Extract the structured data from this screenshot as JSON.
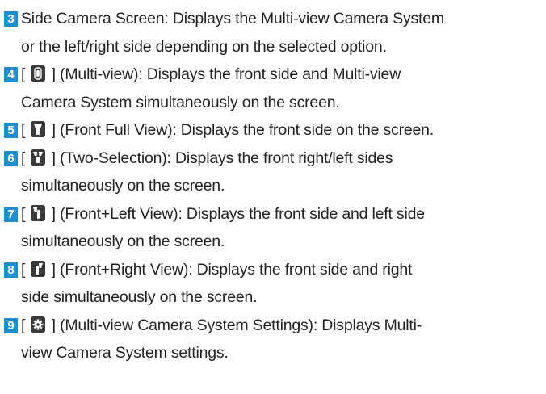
{
  "items": [
    {
      "num": "3",
      "line1": "Side Camera Screen: Displays the Multi-view Camera System",
      "line2": "or the left/right side depending on the selected option."
    },
    {
      "num": "4",
      "icon": "multi-view-icon",
      "line1": "(Multi-view): Displays the front side and Multi-view",
      "line2": "Camera System simultaneously on the screen."
    },
    {
      "num": "5",
      "icon": "front-full-view-icon",
      "line1": "(Front Full View): Displays the front side on the screen."
    },
    {
      "num": "6",
      "icon": "two-selection-icon",
      "line1": "(Two-Selection): Displays the front right/left sides",
      "line2": "simultaneously on the screen."
    },
    {
      "num": "7",
      "icon": "front-left-view-icon",
      "line1": "(Front+Left View): Displays the front side and left side",
      "line2": "simultaneously on the screen."
    },
    {
      "num": "8",
      "icon": "front-right-view-icon",
      "line1": "(Front+Right View): Displays the front side and right",
      "line2": "side simultaneously on the screen."
    },
    {
      "num": "9",
      "icon": "settings-gear-icon",
      "line1": "(Multi-view Camera System Settings): Displays Multi-",
      "line2": "view Camera System settings."
    }
  ],
  "brackets": {
    "open": "[",
    "close": "]"
  },
  "colors": {
    "badge": "#1f8ecf",
    "icon_bg": "#3a3a3a",
    "text": "#222222"
  }
}
